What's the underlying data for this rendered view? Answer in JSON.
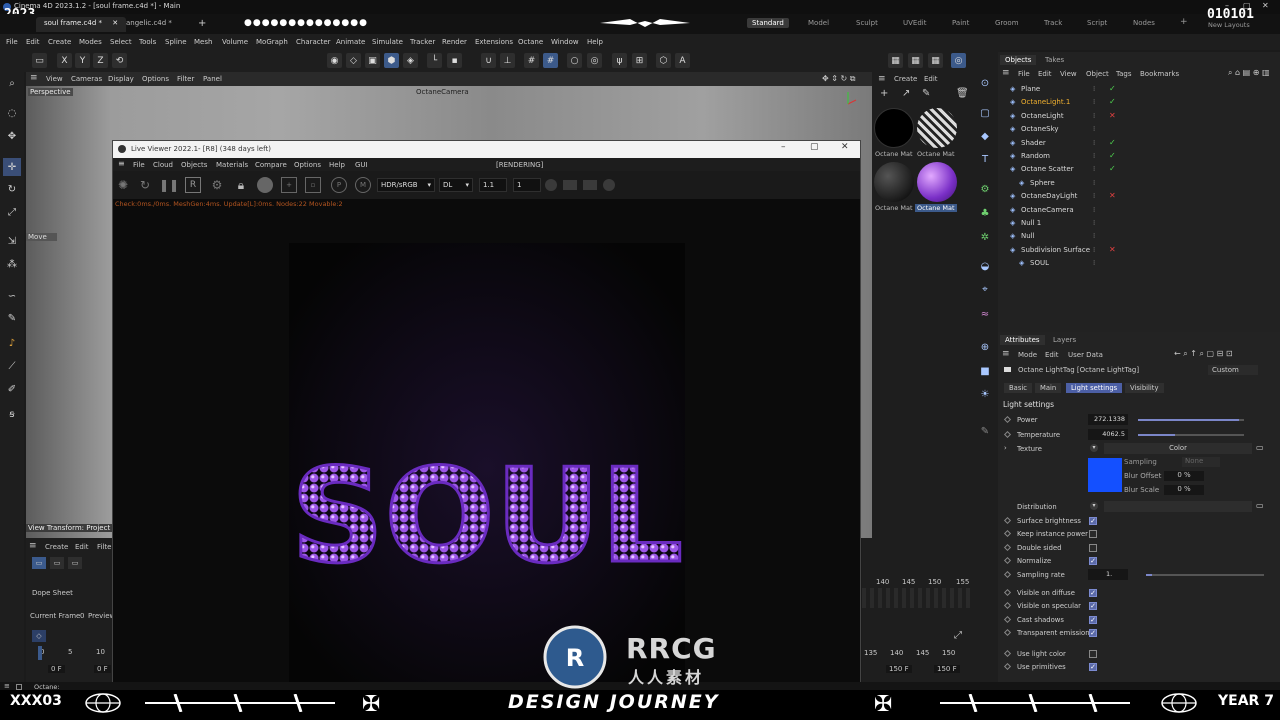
{
  "app": {
    "title": "Cinema 4D 2023.1.2 - [soul frame.c4d *] - Main",
    "doc_tabs": [
      "soul frame.c4d *",
      "angelic.c4d *"
    ],
    "new_tab": "+",
    "layouts": [
      "Standard",
      "Model",
      "Sculpt",
      "UVEdit",
      "Paint",
      "Groom",
      "Track",
      "Script",
      "Nodes"
    ],
    "active_layout": "Standard",
    "new_layouts": "New Layouts",
    "overlay_top_left": "2023",
    "overlay_top_right": "010101"
  },
  "menu": [
    "File",
    "Edit",
    "Create",
    "Modes",
    "Select",
    "Tools",
    "Spline",
    "Mesh",
    "Volume",
    "MoGraph",
    "Character",
    "Animate",
    "Simulate",
    "Tracker",
    "Render",
    "Extensions",
    "Octane",
    "Window",
    "Help"
  ],
  "toolbar": {
    "axes": [
      "X",
      "Y",
      "Z"
    ]
  },
  "viewport": {
    "menu": [
      "View",
      "Cameras",
      "Display",
      "Options",
      "Filter",
      "Panel"
    ],
    "label": "Perspective",
    "camera": "OctaneCamera",
    "move_label": "Move",
    "transform": "View Transform: Project"
  },
  "live_viewer": {
    "title": "Live Viewer 2022.1- [R8] (348 days left)",
    "menu": [
      "File",
      "Cloud",
      "Objects",
      "Materials",
      "Compare",
      "Options",
      "Help",
      "GUI"
    ],
    "status": "[RENDERING]",
    "colorspace": "HDR/sRGB",
    "mode": "DL",
    "val1": "1.1",
    "val2": "1",
    "info": "Check:0ms./0ms. MeshGen:4ms. Update[L]:0ms. Nodes:22 Movable:2",
    "render_text": "SOUL"
  },
  "materials": {
    "menu": [
      "Create",
      "Edit"
    ],
    "items": [
      "Octane Mat",
      "Octane Mat",
      "Octane Mat",
      "Octane Mat"
    ]
  },
  "objects": {
    "tabs": [
      "Objects",
      "Takes"
    ],
    "menu": [
      "File",
      "Edit",
      "View",
      "Object",
      "Tags",
      "Bookmarks"
    ],
    "rows": [
      {
        "name": "Plane",
        "indent": 0,
        "check": "g",
        "highlight": false
      },
      {
        "name": "OctaneLight.1",
        "indent": 0,
        "check": "g",
        "highlight": true
      },
      {
        "name": "OctaneLight",
        "indent": 0,
        "check": "r",
        "highlight": false
      },
      {
        "name": "OctaneSky",
        "indent": 0,
        "check": "",
        "highlight": false
      },
      {
        "name": "Shader",
        "indent": 0,
        "check": "g",
        "highlight": false
      },
      {
        "name": "Random",
        "indent": 0,
        "check": "g",
        "highlight": false
      },
      {
        "name": "Octane Scatter",
        "indent": 0,
        "check": "g",
        "highlight": false
      },
      {
        "name": "Sphere",
        "indent": 1,
        "check": "",
        "highlight": false
      },
      {
        "name": "OctaneDayLight",
        "indent": 0,
        "check": "r",
        "highlight": false
      },
      {
        "name": "OctaneCamera",
        "indent": 0,
        "check": "",
        "highlight": false
      },
      {
        "name": "Null 1",
        "indent": 0,
        "check": "",
        "highlight": false
      },
      {
        "name": "Null",
        "indent": 0,
        "check": "",
        "highlight": false
      },
      {
        "name": "Subdivision Surface",
        "indent": 0,
        "check": "r",
        "highlight": false
      },
      {
        "name": "SOUL",
        "indent": 1,
        "check": "",
        "highlight": false
      }
    ]
  },
  "attributes": {
    "tabs": [
      "Attributes",
      "Layers"
    ],
    "menu": [
      "Mode",
      "Edit",
      "User Data"
    ],
    "tag_title": "Octane LightTag [Octane LightTag]",
    "preset": "Custom",
    "sub_tabs": [
      "Basic",
      "Main",
      "Light settings",
      "Visibility"
    ],
    "active_sub_tab": "Light settings",
    "section": "Light settings",
    "power_label": "Power",
    "power_value": "272.1338",
    "power_fraction": 0.95,
    "temperature_label": "Temperature",
    "temperature_value": "4062.5",
    "temperature_fraction": 0.35,
    "texture_label": "Texture",
    "texture_value": "Color",
    "texture_color": "#1450ff",
    "sampling_label": "Sampling",
    "sampling_value": "None",
    "blur_offset_label": "Blur Offset",
    "blur_offset_value": "0 %",
    "blur_scale_label": "Blur Scale",
    "blur_scale_value": "0 %",
    "distribution_label": "Distribution",
    "checkbox_rows": [
      {
        "label": "Surface brightness",
        "checked": true
      },
      {
        "label": "Keep instance power",
        "checked": false
      },
      {
        "label": "Double sided",
        "checked": false
      },
      {
        "label": "Normalize",
        "checked": true
      }
    ],
    "sampling_rate_label": "Sampling rate",
    "sampling_rate_value": "1.",
    "sampling_rate_fraction": 0.05,
    "vis_rows": [
      {
        "label": "Visible on diffuse",
        "checked": true
      },
      {
        "label": "Visible on specular",
        "checked": true
      },
      {
        "label": "Cast shadows",
        "checked": true
      },
      {
        "label": "Transparent emission",
        "checked": true
      }
    ],
    "extra_rows": [
      {
        "label": "Use light color",
        "checked": false
      },
      {
        "label": "Use primitives",
        "checked": true
      }
    ]
  },
  "timeline": {
    "menu": [
      "Create",
      "Edit",
      "Filte"
    ],
    "dope_sheet": "Dope Sheet",
    "current_frame": "Current Frame",
    "current_frame_value": "0",
    "preview": "Preview",
    "ticks_left": [
      "0",
      "5",
      "10"
    ],
    "frame_left_a": "0 F",
    "frame_left_b": "0 F",
    "ticks_right_top": [
      "140",
      "145",
      "150",
      "155"
    ],
    "ticks_right_bottom": [
      "135",
      "140",
      "145",
      "150"
    ],
    "frame_right_a": "150 F",
    "frame_right_b": "150 F"
  },
  "status": {
    "text": "Octane:"
  },
  "overlay": {
    "left": "XXX03",
    "center": "DESIGN JOURNEY",
    "right": "YEAR 7"
  },
  "watermark": {
    "brand": "RRCG",
    "sub": "人人素材"
  }
}
